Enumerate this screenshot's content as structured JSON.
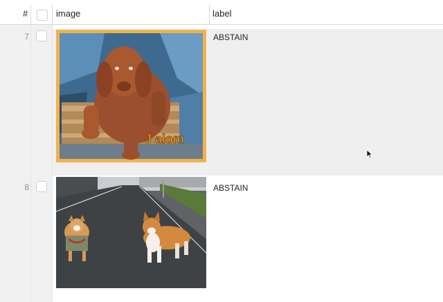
{
  "table": {
    "columns": {
      "index": "#",
      "image": "image",
      "label": "label"
    },
    "rows": [
      {
        "index": "7",
        "label": "ABSTAIN",
        "image_alt": "Brown puppy resting on wooden box",
        "watermark": "J alom"
      },
      {
        "index": "8",
        "label": "ABSTAIN",
        "image_alt": "Two corgi dogs on a wet street"
      }
    ]
  },
  "colors": {
    "header_border": "#d8d8d8",
    "selected_row_bg": "#efefef",
    "index_column_bg": "#f1f1f1"
  },
  "icons": [
    "checkbox-icon",
    "mouse-cursor-icon"
  ]
}
